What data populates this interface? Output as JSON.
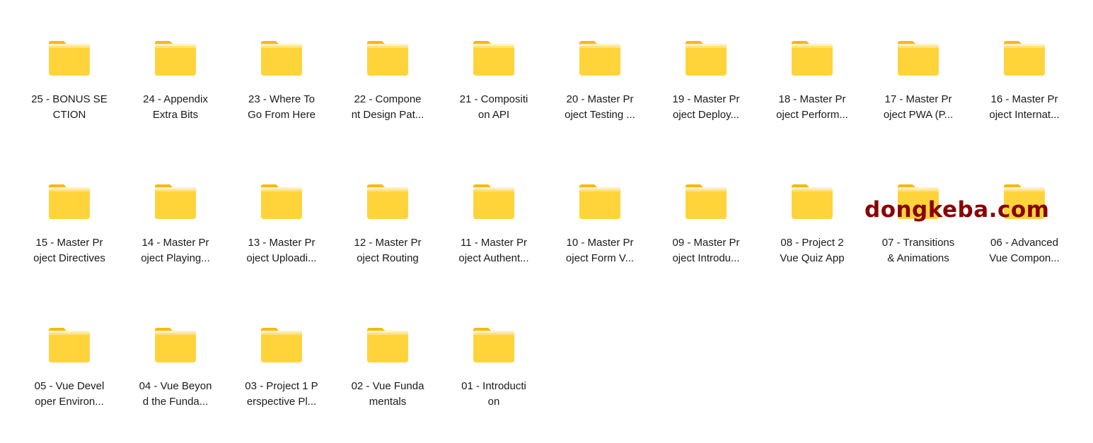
{
  "folders": [
    {
      "label": "25 - BONUS SE\nCTION",
      "icon": "folder-icon"
    },
    {
      "label": "24 - Appendix\nExtra Bits",
      "icon": "folder-icon"
    },
    {
      "label": "23 - Where To\nGo From Here",
      "icon": "folder-icon"
    },
    {
      "label": "22 - Compone\nnt Design Pat...",
      "icon": "folder-icon"
    },
    {
      "label": "21 - Compositi\non API",
      "icon": "folder-icon"
    },
    {
      "label": "20 - Master Pr\noject Testing ...",
      "icon": "folder-icon"
    },
    {
      "label": "19 - Master Pr\noject Deploy...",
      "icon": "folder-icon"
    },
    {
      "label": "18 - Master Pr\noject Perform...",
      "icon": "folder-icon"
    },
    {
      "label": "17 - Master Pr\noject PWA (P...",
      "icon": "folder-icon"
    },
    {
      "label": "16 - Master Pr\noject Internat...",
      "icon": "folder-icon"
    },
    {
      "label": "15 - Master Pr\noject Directives",
      "icon": "folder-icon"
    },
    {
      "label": "14 - Master Pr\noject Playing...",
      "icon": "folder-icon"
    },
    {
      "label": "13 - Master Pr\noject Uploadi...",
      "icon": "folder-icon"
    },
    {
      "label": "12 - Master Pr\noject Routing",
      "icon": "folder-icon"
    },
    {
      "label": "11 - Master Pr\noject Authent...",
      "icon": "folder-icon"
    },
    {
      "label": "10 - Master Pr\noject Form V...",
      "icon": "folder-icon"
    },
    {
      "label": "09 - Master Pr\noject Introdu...",
      "icon": "folder-icon"
    },
    {
      "label": "08 - Project 2\nVue Quiz App",
      "icon": "folder-icon"
    },
    {
      "label": "07 - Transitions\n& Animations",
      "icon": "folder-icon"
    },
    {
      "label": "06 - Advanced\nVue Compon...",
      "icon": "folder-icon"
    },
    {
      "label": "05 - Vue Devel\noper Environ...",
      "icon": "folder-icon"
    },
    {
      "label": "04 - Vue Beyon\nd the Funda...",
      "icon": "folder-icon"
    },
    {
      "label": "03 - Project 1 P\nerspective Pl...",
      "icon": "folder-icon"
    },
    {
      "label": "02 - Vue Funda\nmentals",
      "icon": "folder-icon"
    },
    {
      "label": "01 - Introducti\non",
      "icon": "folder-icon"
    }
  ],
  "watermark": {
    "text": "dongkeba.com",
    "color": "#8b0000"
  },
  "colors": {
    "folder_back": "#F6B90C",
    "folder_front": "#FFD43B",
    "background": "#ffffff"
  }
}
